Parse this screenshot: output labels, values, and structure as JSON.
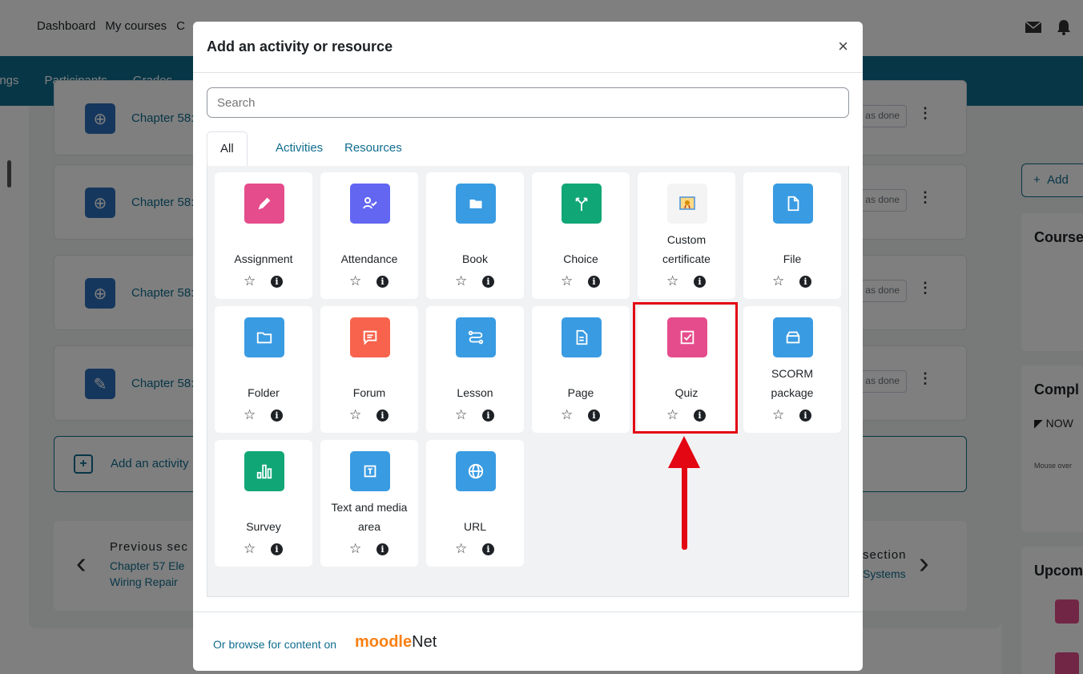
{
  "background": {
    "topnav": {
      "links": [
        "Dashboard",
        "My courses",
        "C"
      ]
    },
    "secnav": {
      "items": [
        "ings",
        "Participants",
        "Grades"
      ]
    },
    "activities": [
      {
        "name": "Chapter 58:",
        "done": "as done"
      },
      {
        "name": "Chapter 58:",
        "done": "as done"
      },
      {
        "name": "Chapter 58:",
        "done": "as done"
      },
      {
        "name": "Chapter 58:",
        "done": "as done"
      }
    ],
    "add_activity_label": "Add an activity",
    "prev_title": "Previous sec",
    "prev_link": "Chapter 57 Ele Wiring Repair",
    "next_title": "section",
    "next_link": "Systems",
    "right_drawer": {
      "add_label": "Add",
      "block1_title": "Course",
      "block2_title": "Compl",
      "now_label": "NOW",
      "mouse_text": "Mouse over",
      "block3_title": "Upcom"
    }
  },
  "modal": {
    "title": "Add an activity or resource",
    "close_label": "×",
    "search_placeholder": "Search",
    "tabs": [
      "All",
      "Activities",
      "Resources"
    ],
    "items": [
      {
        "name": "Assignment",
        "icon": "pencil-icon",
        "color": "#e54c8b"
      },
      {
        "name": "Attendance",
        "icon": "attendance-icon",
        "color": "#6366f1"
      },
      {
        "name": "Book",
        "icon": "book-icon",
        "color": "#399be2"
      },
      {
        "name": "Choice",
        "icon": "choice-icon",
        "color": "#11a676"
      },
      {
        "name": "Custom certificate",
        "icon": "certificate-icon",
        "color": "#f4f4f4"
      },
      {
        "name": "File",
        "icon": "file-icon",
        "color": "#399be2"
      },
      {
        "name": "Folder",
        "icon": "folder-icon",
        "color": "#399be2"
      },
      {
        "name": "Forum",
        "icon": "forum-icon",
        "color": "#f7634d"
      },
      {
        "name": "Lesson",
        "icon": "lesson-icon",
        "color": "#399be2"
      },
      {
        "name": "Page",
        "icon": "page-icon",
        "color": "#399be2"
      },
      {
        "name": "Quiz",
        "icon": "quiz-icon",
        "color": "#e54c8b"
      },
      {
        "name": "SCORM package",
        "icon": "scorm-icon",
        "color": "#399be2"
      },
      {
        "name": "Survey",
        "icon": "survey-icon",
        "color": "#11a676"
      },
      {
        "name": "Text and media area",
        "icon": "text-media-icon",
        "color": "#399be2"
      },
      {
        "name": "URL",
        "icon": "url-icon",
        "color": "#399be2"
      }
    ],
    "footer_browse": "Or browse for content on",
    "moodlenet_moodle": "moodle",
    "moodlenet_net": "Net"
  },
  "annotation": {
    "color": "#e30613",
    "target": "Quiz"
  }
}
